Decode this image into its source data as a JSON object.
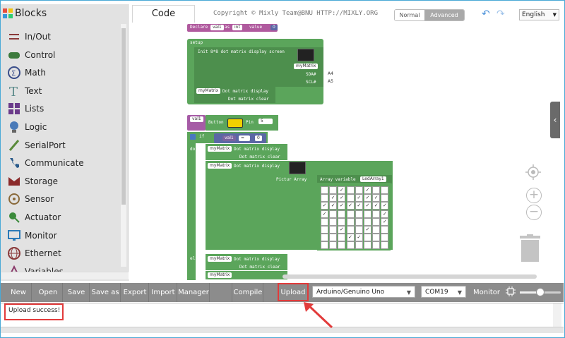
{
  "sidebar": {
    "title": "Blocks",
    "items": [
      {
        "label": "In/Out",
        "icon": "inout-icon",
        "color": "#8a3a3a"
      },
      {
        "label": "Control",
        "icon": "gamepad-icon",
        "color": "#3c7a3c"
      },
      {
        "label": "Math",
        "icon": "math-icon",
        "color": "#3a4e8a"
      },
      {
        "label": "Text",
        "icon": "text-icon",
        "color": "#5a8a8a"
      },
      {
        "label": "Lists",
        "icon": "lists-icon",
        "color": "#6a3a8a"
      },
      {
        "label": "Logic",
        "icon": "bulb-icon",
        "color": "#4a7ab8"
      },
      {
        "label": "SerialPort",
        "icon": "pen-icon",
        "color": "#5a8a3a"
      },
      {
        "label": "Communicate",
        "icon": "phone-icon",
        "color": "#2a5a8a"
      },
      {
        "label": "Storage",
        "icon": "storage-icon",
        "color": "#8a2a2a"
      },
      {
        "label": "Sensor",
        "icon": "sensor-icon",
        "color": "#8a6a3a"
      },
      {
        "label": "Actuator",
        "icon": "actuator-icon",
        "color": "#3a8a3a"
      },
      {
        "label": "Monitor",
        "icon": "monitor-icon",
        "color": "#2a7ab8"
      },
      {
        "label": "Ethernet",
        "icon": "globe-icon",
        "color": "#8a3a3a"
      },
      {
        "label": "Variables",
        "icon": "variables-icon",
        "color": "#8a3a6a"
      }
    ]
  },
  "header": {
    "tab_label": "Code",
    "copyright": "Copyright © Mixly Team@BNU HTTP://MIXLY.ORG",
    "mode_normal": "Normal",
    "mode_advanced": "Advanced",
    "language": "English"
  },
  "blocks": {
    "declare": "Declare",
    "declare_var": "val1",
    "declare_as": "as",
    "declare_type": "int",
    "declare_value": "value",
    "declare_num": "0",
    "setup": "setup",
    "init_text": "Init 8*8 dot matrix display screen",
    "my_matrix": "myMatrix",
    "sda": "SDA#",
    "sda_val": "A4",
    "scl": "SCL#",
    "scl_val": "A5",
    "dot_display": "Dot matrix display",
    "dot_clear": "Dot matrix clear",
    "button_var": "val1",
    "button": "Button",
    "pin": "Pin",
    "pin_val": "5",
    "if_label": "if",
    "if_var": "val1",
    "if_op": "=",
    "if_num": "0",
    "do_label": "do",
    "pictur_array": "Pictur Array",
    "array_var": "Array variable",
    "array_name": "LedArray1",
    "else_label": "else"
  },
  "led_grid": [
    [
      0,
      0,
      1,
      0,
      0,
      1,
      0,
      0
    ],
    [
      0,
      1,
      1,
      0,
      1,
      1,
      1,
      0
    ],
    [
      1,
      1,
      1,
      1,
      1,
      1,
      1,
      1
    ],
    [
      1,
      0,
      0,
      0,
      0,
      0,
      0,
      1
    ],
    [
      0,
      0,
      0,
      0,
      0,
      0,
      0,
      1
    ],
    [
      0,
      0,
      1,
      0,
      0,
      1,
      0,
      0
    ],
    [
      0,
      0,
      0,
      1,
      1,
      0,
      0,
      0
    ],
    [
      0,
      0,
      0,
      0,
      0,
      0,
      0,
      0
    ]
  ],
  "toolbar": {
    "new": "New",
    "open": "Open",
    "save": "Save",
    "save_as": "Save as",
    "export": "Export",
    "import": "Import",
    "manager": "Manager",
    "compile": "Compile",
    "upload": "Upload",
    "board": "Arduino/Genuino Uno",
    "port": "COM19",
    "monitor": "Monitor"
  },
  "console": {
    "status": "Upload success!"
  }
}
